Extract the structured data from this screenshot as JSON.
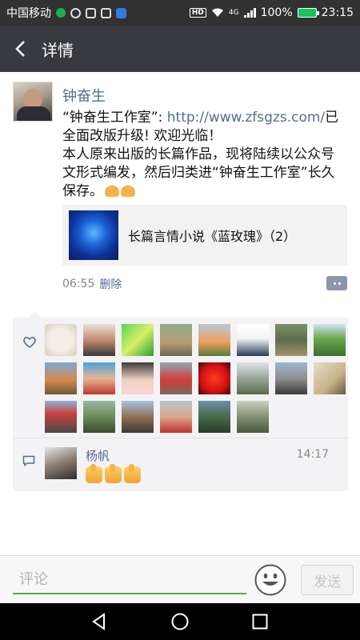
{
  "status_bar": {
    "carrier": "中国移动",
    "hd": "HD",
    "network": "4G",
    "battery_percent": "100%",
    "time": "23:15"
  },
  "header": {
    "title": "详情",
    "back_icon": "chevron-left-icon"
  },
  "post": {
    "author": "钟奋生",
    "text_prefix": "“钟奋生工作室”: ",
    "link": "http://www.zfsgzs.com/",
    "text_line1_suffix": "已全面改版升级! 欢迎光临！",
    "text_body": "本人原来出版的长篇作品，现将陆续以公众号文形式编发，然后归类进“钟奋生工作室”长久保存。",
    "shared_article_title": "长篇言情小说《蓝玫瑰》（2）",
    "time": "06:55",
    "delete_label": "删除"
  },
  "likes": {
    "icon": "heart-icon",
    "count": 23
  },
  "comments": [
    {
      "author": "杨帆",
      "time": "14:17",
      "content_icons": [
        "thumbs-up-emoji",
        "thumbs-up-emoji",
        "thumbs-up-emoji"
      ]
    }
  ],
  "input_bar": {
    "placeholder": "评论",
    "send_label": "发送",
    "emoji_icon": "smiley-icon"
  },
  "colors": {
    "link_blue": "#576b95",
    "title_bar": "#393a3f",
    "status_bar": "#333232",
    "input_underline": "#4cae4c"
  }
}
